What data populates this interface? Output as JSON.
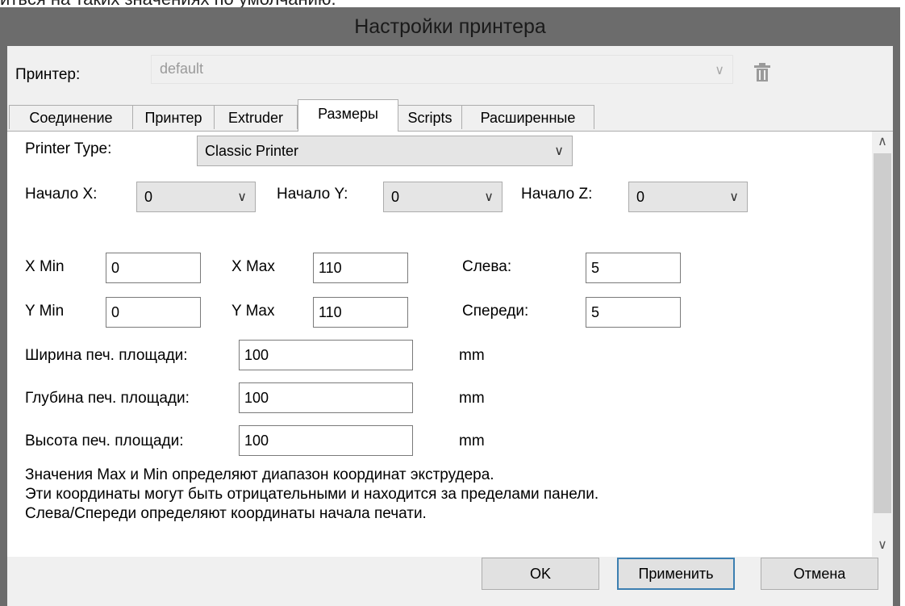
{
  "page_above_text": "иться на таких значениях по умолчанию.",
  "window": {
    "title": "Настройки принтера"
  },
  "printer": {
    "label": "Принтер:",
    "value": "default"
  },
  "icons": {
    "delete": "trash-icon",
    "dropdown": "chevron-down-icon",
    "scroll_up": "chevron-up-icon",
    "scroll_down": "chevron-down-icon"
  },
  "tabs": [
    {
      "label": "Соединение"
    },
    {
      "label": "Принтер"
    },
    {
      "label": "Extruder"
    },
    {
      "label": "Размеры",
      "active": true
    },
    {
      "label": "Scripts"
    },
    {
      "label": "Расширенные"
    }
  ],
  "dimensions": {
    "printer_type": {
      "label": "Printer Type:",
      "value": "Classic Printer"
    },
    "home_x": {
      "label": "Начало X:",
      "value": "0"
    },
    "home_y": {
      "label": "Начало Y:",
      "value": "0"
    },
    "home_z": {
      "label": "Начало Z:",
      "value": "0"
    },
    "x_min": {
      "label": "X Min",
      "value": "0"
    },
    "x_max": {
      "label": "X Max",
      "value": "110"
    },
    "left": {
      "label": "Слева:",
      "value": "5"
    },
    "y_min": {
      "label": "Y Min",
      "value": "0"
    },
    "y_max": {
      "label": "Y Max",
      "value": "110"
    },
    "front": {
      "label": "Спереди:",
      "value": "5"
    },
    "bed_width": {
      "label": "Ширина печ. площади:",
      "value": "100",
      "unit": "mm"
    },
    "bed_depth": {
      "label": "Глубина печ. площади:",
      "value": "100",
      "unit": "mm"
    },
    "bed_height": {
      "label": "Высота печ. площади:",
      "value": "100",
      "unit": "mm"
    },
    "notes": [
      "Значения Max и Min определяют диапазон координат экструдера.",
      "Эти координаты могут быть отрицательными и находится за пределами панели.",
      "Слева/Спереди определяют координаты начала печати."
    ]
  },
  "buttons": {
    "ok": "OK",
    "apply": "Применить",
    "cancel": "Отмена"
  },
  "colors": {
    "titlebar": "#6c6c6c",
    "dialog_bg": "#f0f0f0",
    "panel_bg": "#ffffff",
    "default_button_border": "#3c7fb1"
  }
}
